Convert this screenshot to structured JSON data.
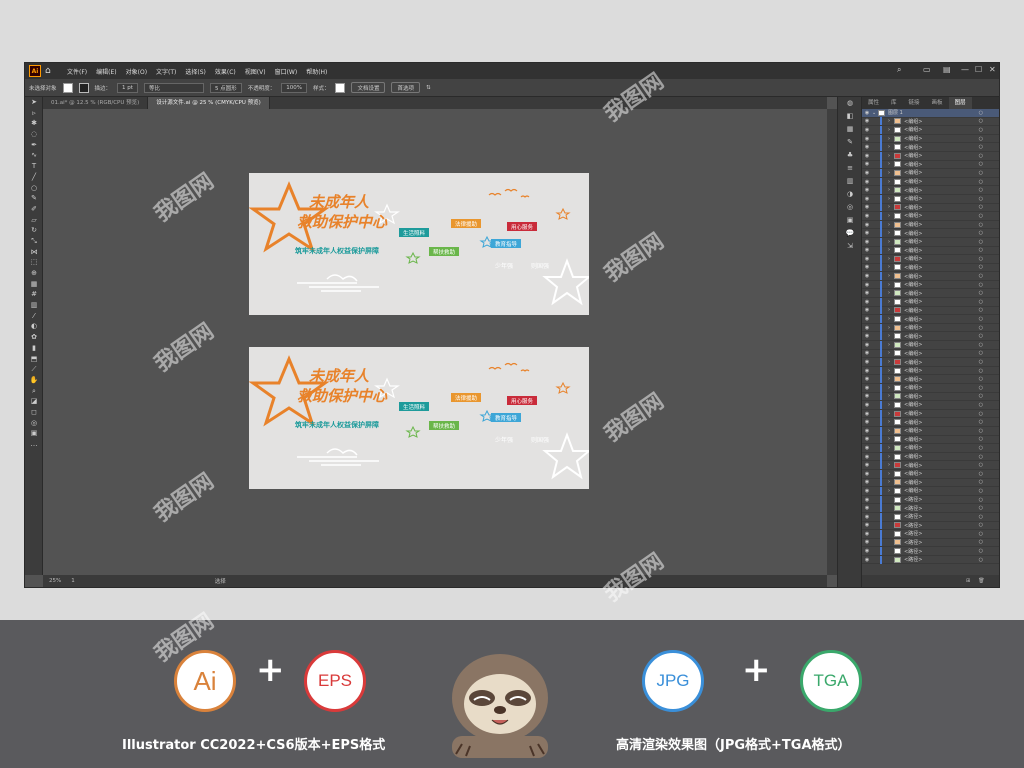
{
  "menu": {
    "items": [
      "文件(F)",
      "编辑(E)",
      "对象(O)",
      "文字(T)",
      "选择(S)",
      "效果(C)",
      "视图(V)",
      "窗口(W)",
      "帮助(H)"
    ]
  },
  "control_bar": {
    "selection": "未选择对象",
    "stroke_label": "描边：",
    "stroke_value": "1 pt",
    "stroke_style": "等比",
    "brush": "5 点圆形",
    "opacity_label": "不透明度：",
    "opacity_value": "100%",
    "style_label": "样式：",
    "doc_setup": "文档设置",
    "preferences": "首选项"
  },
  "tabs": [
    {
      "label": "01.ai* @ 12.5 % (RGB/CPU 预览)"
    },
    {
      "label": "设计源文件.ai @ 25 % (CMYK/CPU 预览)"
    }
  ],
  "status": {
    "zoom": "25%",
    "page": "1",
    "tool": "选择"
  },
  "panel_tabs": [
    "属性",
    "库",
    "链接",
    "画板",
    "图层"
  ],
  "layers": {
    "top": "图层 1",
    "group": "<编组>",
    "path": "<路径>",
    "group_count": 44,
    "path_count": 8
  },
  "artboard": {
    "title_line1": "未成年人",
    "title_line2": "救助保护中心",
    "tagline": "筑牢未成年人权益保护屏障",
    "labels": {
      "life": "生活照料",
      "legal": "法律援助",
      "care": "用心服务",
      "assist": "帮扶救助",
      "edu": "教育指导"
    },
    "white1": "少年强",
    "white2": "则国强"
  },
  "footer": {
    "ai": "Ai",
    "eps": "EPS",
    "jpg": "JPG",
    "tga": "TGA",
    "plus": "+",
    "caption_left": "Illustrator CC2022+CS6版本+EPS格式",
    "caption_right": "高清渲染效果图（JPG格式+TGA格式）"
  },
  "colors": {
    "orange": "#e8822a",
    "teal": "#1e9b9b",
    "red": "#c92b3a",
    "green": "#6ab64a",
    "blue": "#3da6d7",
    "ai_badge": "#d9823b",
    "eps_badge": "#d93a3a",
    "jpg_badge": "#3a8fd9",
    "tga_badge": "#3aa86b"
  },
  "watermark": "我图网"
}
